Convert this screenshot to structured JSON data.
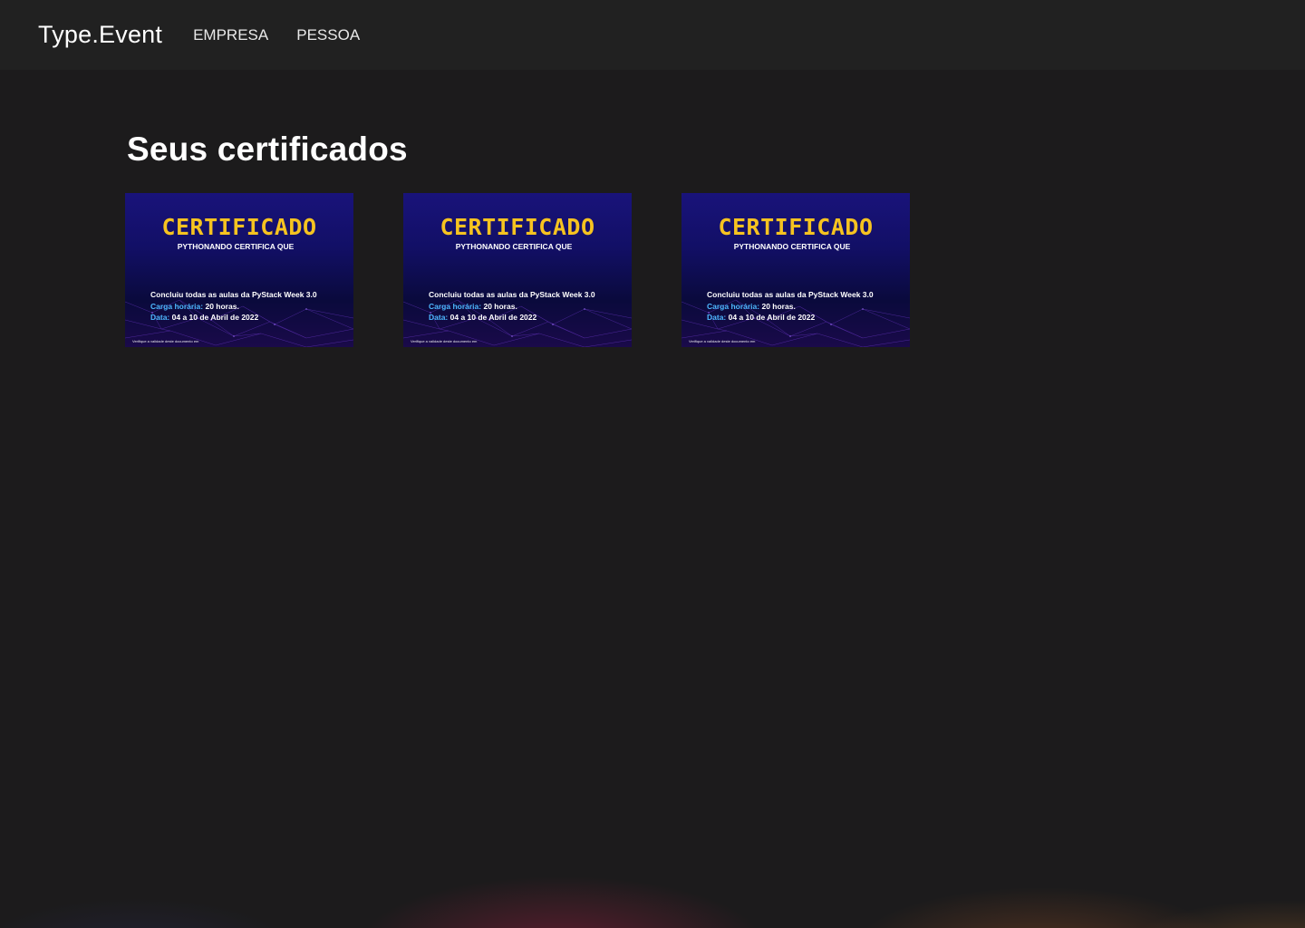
{
  "navbar": {
    "brand": "Type.Event",
    "links": [
      "EMPRESA",
      "PESSOA"
    ]
  },
  "page": {
    "title": "Seus certificados"
  },
  "certificates": [
    {
      "heading": "CERTIFICADO",
      "subheading": "PYTHONANDO CERTIFICA QUE",
      "line1": "Concluiu todas as aulas da PyStack Week 3.0",
      "hours_label": "Carga horária:",
      "hours_value": "20 horas.",
      "date_label": "Data:",
      "date_value": "04 a 10 de Abril de 2022",
      "footer": "Verifique a validade deste documento em"
    },
    {
      "heading": "CERTIFICADO",
      "subheading": "PYTHONANDO CERTIFICA QUE",
      "line1": "Concluiu todas as aulas da PyStack Week 3.0",
      "hours_label": "Carga horária:",
      "hours_value": "20 horas.",
      "date_label": "Data:",
      "date_value": "04 a 10 de Abril de 2022",
      "footer": "Verifique a validade deste documento em"
    },
    {
      "heading": "CERTIFICADO",
      "subheading": "PYTHONANDO CERTIFICA QUE",
      "line1": "Concluiu todas as aulas da PyStack Week 3.0",
      "hours_label": "Carga horária:",
      "hours_value": "20 horas.",
      "date_label": "Data:",
      "date_value": "04 a 10 de Abril de 2022",
      "footer": "Verifique a validade deste documento em"
    }
  ],
  "colors": {
    "background": "#1c1b1c",
    "navbar": "#212121",
    "certificate_heading": "#f6c320",
    "certificate_accent": "#4db8ff",
    "certificate_bg": "#120f66"
  }
}
